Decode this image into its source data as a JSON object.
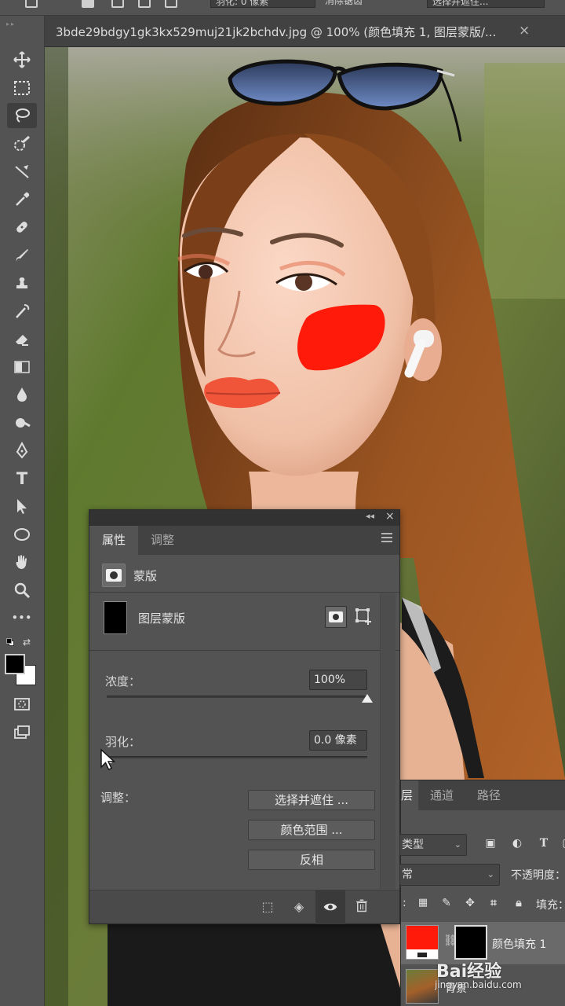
{
  "app": {
    "document_tab": {
      "title": "3bde29bdgy1gk3kx529muj21jk2bchdv.jpg @ 100% (颜色填充 1, 图层蒙版/...",
      "close_glyph": "×"
    },
    "options_bar": {
      "partial_field_1": "羽化: 0 像素",
      "partial_text_1": "消除锯齿",
      "partial_button": "选择并遮住..."
    }
  },
  "toolbar": {
    "tools": [
      {
        "name": "move-tool",
        "icon": "move-icon"
      },
      {
        "name": "marquee-tool",
        "icon": "rect-marquee-icon"
      },
      {
        "name": "lasso-tool",
        "icon": "lasso-icon",
        "active": true
      },
      {
        "name": "quick-select-tool",
        "icon": "quick-select-icon"
      },
      {
        "name": "crop-tool",
        "icon": "crop-icon"
      },
      {
        "name": "eyedropper-tool",
        "icon": "eyedropper-icon"
      },
      {
        "name": "healing-tool",
        "icon": "bandage-icon"
      },
      {
        "name": "brush-tool",
        "icon": "brush-icon"
      },
      {
        "name": "stamp-tool",
        "icon": "stamp-icon"
      },
      {
        "name": "history-brush-tool",
        "icon": "history-brush-icon"
      },
      {
        "name": "eraser-tool",
        "icon": "eraser-icon"
      },
      {
        "name": "gradient-tool",
        "icon": "gradient-icon"
      },
      {
        "name": "blur-tool",
        "icon": "drop-icon"
      },
      {
        "name": "dodge-tool",
        "icon": "dodge-icon"
      },
      {
        "name": "pen-tool",
        "icon": "pen-icon"
      },
      {
        "name": "type-tool",
        "icon": "type-icon",
        "glyph": "T"
      },
      {
        "name": "path-select-tool",
        "icon": "arrow-icon"
      },
      {
        "name": "ellipse-tool",
        "icon": "ellipse-icon"
      },
      {
        "name": "hand-tool",
        "icon": "hand-icon"
      },
      {
        "name": "zoom-tool",
        "icon": "zoom-icon"
      },
      {
        "name": "more-tools",
        "icon": "ellipsis-icon",
        "glyph": "•••"
      }
    ],
    "foreground_color": "#000000",
    "background_color": "#ffffff"
  },
  "properties_panel": {
    "tabs": [
      "属性",
      "调整"
    ],
    "active_tab": 0,
    "section_title": "蒙版",
    "mask_label": "图层蒙版",
    "density": {
      "label": "浓度：",
      "value": "100%",
      "level": 1.0
    },
    "feather": {
      "label": "羽化：",
      "value": "0.0 像素",
      "level": 0.0
    },
    "adjust_label": "调整：",
    "buttons": [
      "选择并遮住 ...",
      "颜色范围 ...",
      "反相"
    ],
    "close_glyph": "×",
    "collapse_glyph": "◂◂"
  },
  "layers_panel": {
    "tabs": [
      "图层",
      "通道",
      "路径"
    ],
    "visible_tab_labels": [
      "层",
      "通道",
      "路径"
    ],
    "active_tab": 0,
    "filter_kind": "类型",
    "blend_mode": "正常",
    "blend_mode_visible": "常",
    "opacity_label": "不透明度：",
    "lock_label": "锁定：",
    "fill_label": "填充：",
    "layers": [
      {
        "name": "颜色填充 1",
        "fill_color": "#ff1a0a",
        "selected": true,
        "visible": true
      },
      {
        "name": "背景",
        "selected": false,
        "visible": true
      }
    ]
  },
  "watermark": {
    "brand": "Bai经验",
    "url": "jingyan.baidu.com"
  },
  "colors": {
    "panel_bg": "#535353",
    "panel_dark": "#424242",
    "blush_red": "#ff1a0a"
  }
}
